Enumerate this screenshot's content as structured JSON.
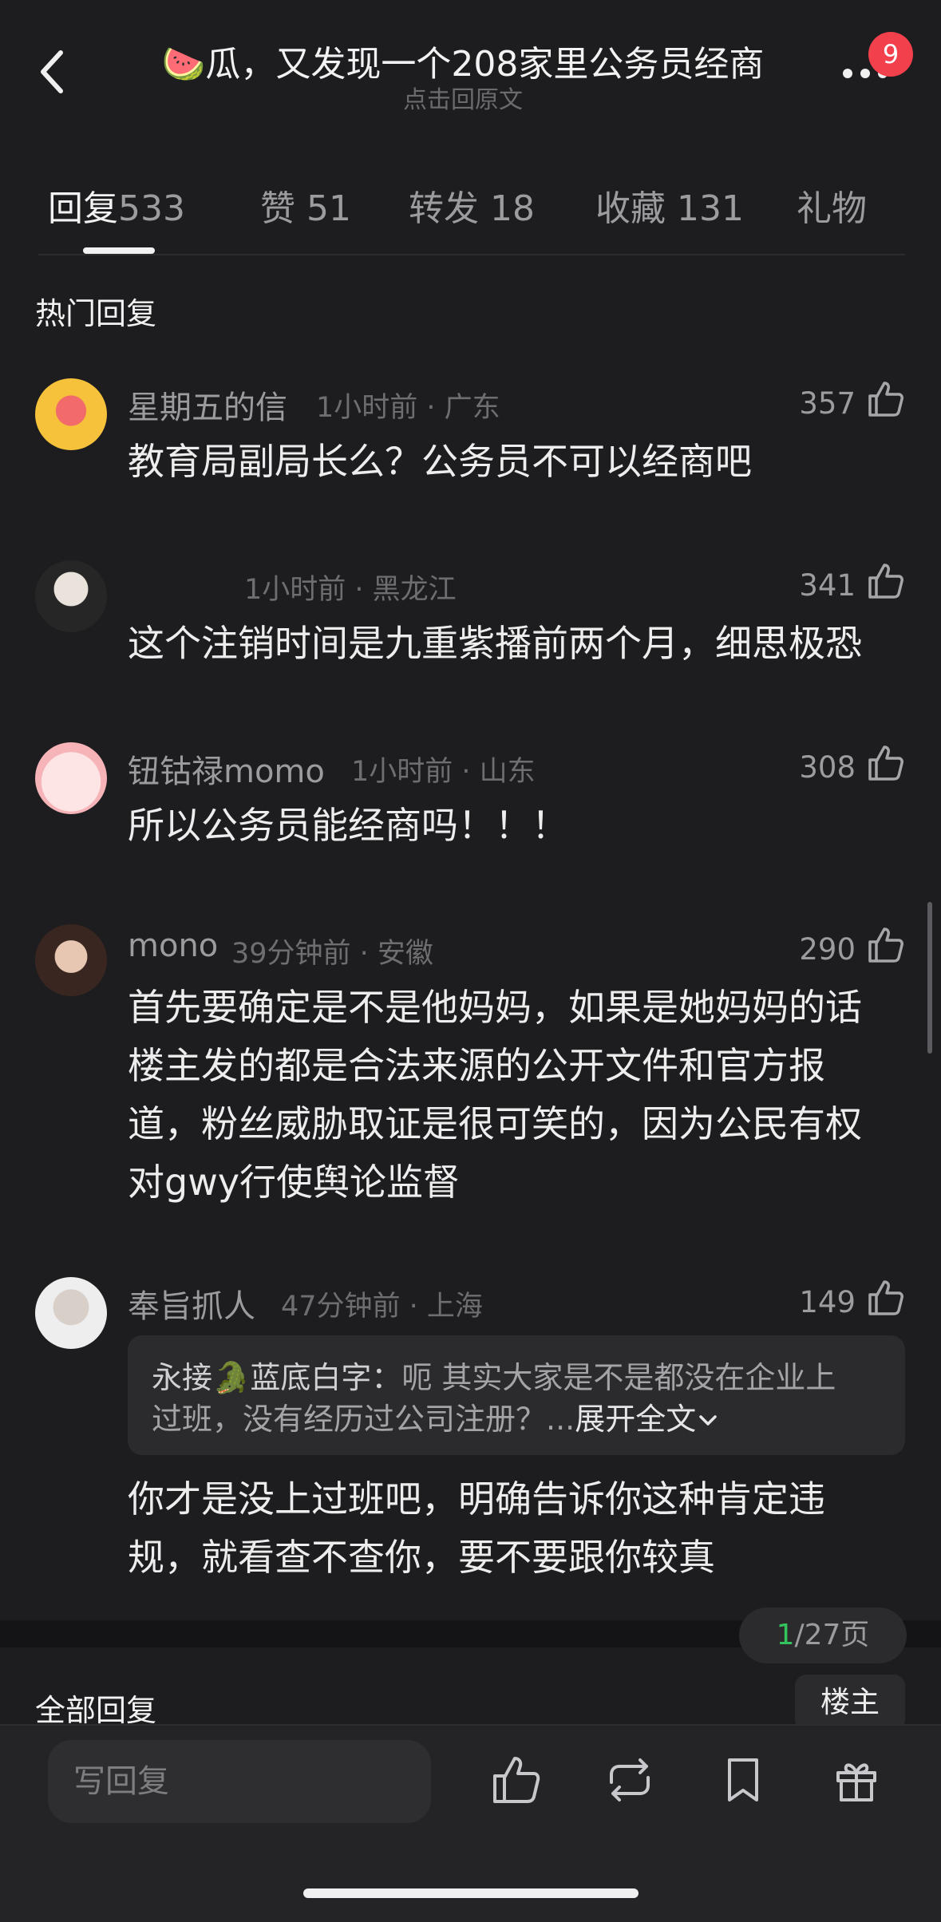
{
  "header": {
    "title": "🍉瓜，又发现一个208家里公务员经商",
    "subtitle": "点击回原文",
    "notification_count": "9"
  },
  "tabs": [
    {
      "label": "回复",
      "count": "533"
    },
    {
      "label": "赞",
      "count": "51"
    },
    {
      "label": "转发",
      "count": "18"
    },
    {
      "label": "收藏",
      "count": "131"
    },
    {
      "label": "礼物",
      "count": ""
    }
  ],
  "hot_section_title": "热门回复",
  "comments": [
    {
      "name": "星期五的信",
      "meta": "1小时前 · 广东",
      "likes": "357",
      "text": "教育局副局长么？公务员不可以经商吧"
    },
    {
      "name": "",
      "meta": "1小时前 · 黑龙江",
      "likes": "341",
      "text": "这个注销时间是九重紫播前两个月，细思极恐"
    },
    {
      "name": "钮钴禄momo",
      "meta": "1小时前 · 山东",
      "likes": "308",
      "text": "所以公务员能经商吗！！！"
    },
    {
      "name": "mono",
      "meta": "39分钟前 · 安徽",
      "likes": "290",
      "lines": [
        "首先要确定是不是他妈妈，如果是她妈妈的话",
        "楼主发的都是合法来源的公开文件和官方报",
        "道，粉丝威胁取证是很可笑的，因为公民有权",
        "对gwy行使舆论监督"
      ]
    },
    {
      "name": "奉旨抓人",
      "meta": "47分钟前 · 上海",
      "likes": "149",
      "quote": {
        "name": "永接🐊蓝底白字：",
        "line1": "呃 其实大家是不是都没在企业上",
        "line2": "过班，没有经历过公司注册？...",
        "expand": "展开全文"
      },
      "lines": [
        "你才是没上过班吧，明确告诉你这种肯定违",
        "规，就看查不查你，要不要跟你较真"
      ]
    }
  ],
  "pager": {
    "current": "1",
    "total": "/27页"
  },
  "all_replies_title": "全部回复",
  "owner_button": "楼主",
  "bottom_bar": {
    "input_placeholder": "写回复"
  },
  "colors": {
    "background": "#1d1d1f",
    "badge": "#f2404d",
    "page_current": "#33c45d"
  }
}
